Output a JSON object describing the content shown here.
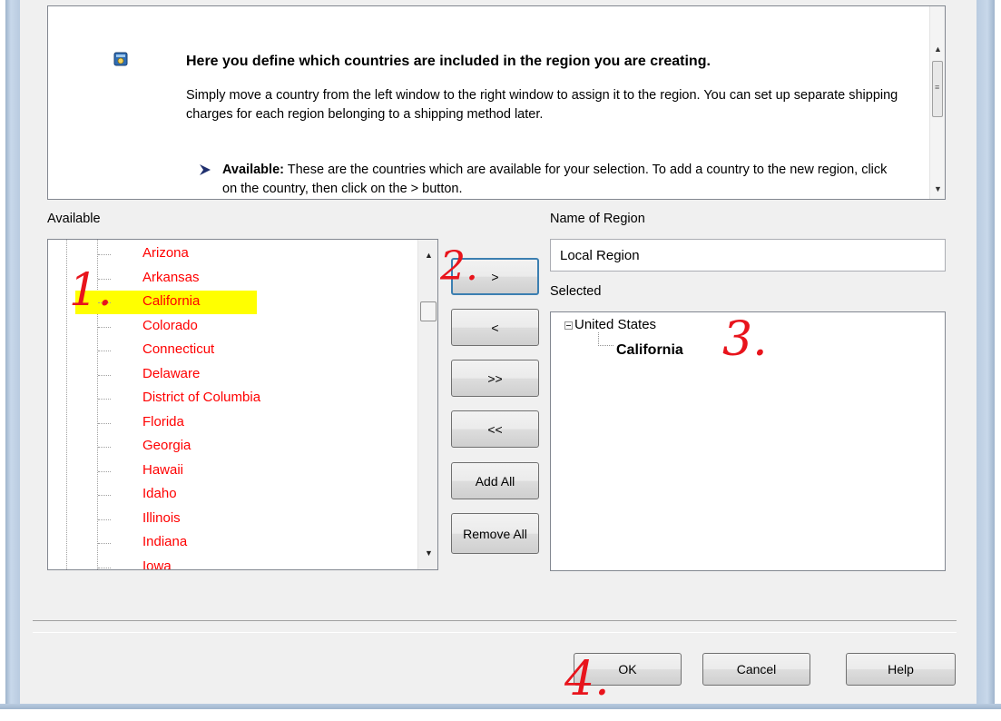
{
  "info": {
    "icon": "wizard-info-icon",
    "title": "Here you define which countries are included in the region you are creating.",
    "body": "Simply move a country from the left window to the right window to assign it to the region. You can set up separate shipping charges for each region belonging to a shipping method later.",
    "bullet_label": "Available:",
    "bullet_text": " These are the countries which are available for your selection. To add a country to the new region, click on the country, then click on the > button."
  },
  "available": {
    "label": "Available",
    "items": [
      "Arizona",
      "Arkansas",
      "California",
      "Colorado",
      "Connecticut",
      "Delaware",
      "District of Columbia",
      "Florida",
      "Georgia",
      "Hawaii",
      "Idaho",
      "Illinois",
      "Indiana",
      "Iowa"
    ],
    "selected_item": "California",
    "item_color": "#ff0000",
    "highlight_color": "#ffff00"
  },
  "buttons": {
    "add": ">",
    "remove": "<",
    "add_all_arrows": ">>",
    "remove_all_arrows": "<<",
    "add_all": "Add All",
    "remove_all": "Remove All"
  },
  "region": {
    "name_label": "Name of Region",
    "name_value": "Local Region",
    "selected_label": "Selected",
    "root": "United States",
    "children": [
      "California"
    ]
  },
  "footer": {
    "ok": "OK",
    "cancel": "Cancel",
    "help": "Help"
  },
  "annotations": {
    "step1": "1.",
    "step2": "2.",
    "step3": "3.",
    "step4": "4.",
    "color": "#e8141c"
  }
}
